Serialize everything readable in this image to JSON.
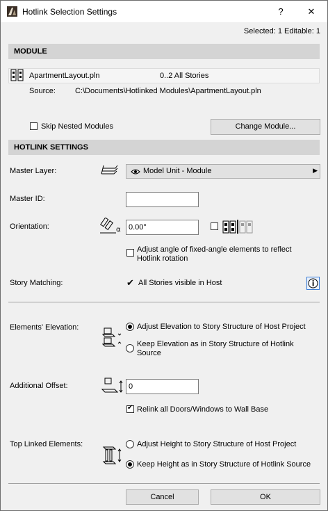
{
  "window": {
    "title": "Hotlink Selection Settings",
    "help_label": "?",
    "close_label": "✕"
  },
  "status": {
    "selected_text": "Selected: 1 Editable: 1"
  },
  "module": {
    "header": "MODULE",
    "file_name": "ApartmentLayout.pln",
    "stories": "0..2 All Stories",
    "source_label": "Source:",
    "source_path": "C:\\Documents\\Hotlinked Modules\\ApartmentLayout.pln",
    "skip_nested_label": "Skip Nested Modules",
    "skip_nested_checked": false,
    "change_module_label": "Change Module..."
  },
  "hotlink": {
    "header": "HOTLINK SETTINGS",
    "master_layer_label": "Master Layer:",
    "master_layer_value": "Model Unit - Module",
    "master_id_label": "Master ID:",
    "master_id_value": "",
    "orientation_label": "Orientation:",
    "orientation_value": "0.00°",
    "mirror_checked": false,
    "adjust_angle_label_1": "Adjust angle of fixed-angle elements to reflect",
    "adjust_angle_label_2": "Hotlink rotation",
    "adjust_angle_checked": false,
    "story_matching_label": "Story Matching:",
    "story_matching_value": "All Stories visible in Host",
    "elements_elevation_label": "Elements' Elevation:",
    "elev_option_1": "Adjust Elevation to Story Structure of Host Project",
    "elev_option_2a": "Keep Elevation as in Story Structure of Hotlink",
    "elev_option_2b": "Source",
    "elev_selected": 1,
    "additional_offset_label": "Additional Offset:",
    "additional_offset_value": "0",
    "relink_label": "Relink all Doors/Windows to Wall Base",
    "relink_checked": true,
    "top_linked_label": "Top Linked Elements:",
    "top_option_1": "Adjust Height to Story Structure of Host Project",
    "top_option_2": "Keep Height as in Story Structure of Hotlink Source",
    "top_selected": 2
  },
  "footer": {
    "cancel_label": "Cancel",
    "ok_label": "OK"
  }
}
